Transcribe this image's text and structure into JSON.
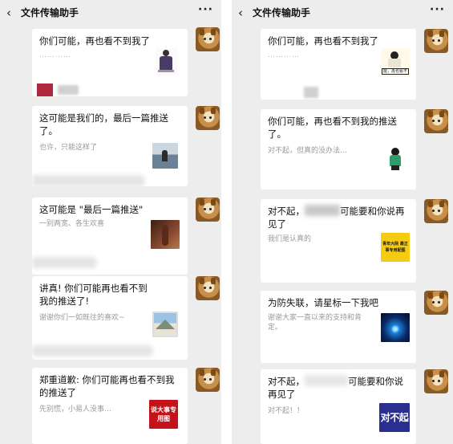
{
  "left": {
    "header": {
      "back_icon": "chevron-left-icon",
      "title": "文件传输助手",
      "more_label": "···"
    },
    "cards": [
      {
        "title": "你们可能，再也看不到我了",
        "desc": "…………",
        "thumb": "figure"
      },
      {
        "title": "这可能是我们的，最后一篇推送了。",
        "desc": "也许，只能这样了",
        "thumb": "sea"
      },
      {
        "title": "这可能是 \"最后一篇推送\"",
        "desc": "一别两宽、各生欢喜",
        "thumb": "dark"
      },
      {
        "title": "讲真! 你们可能再也看不到我的推送了!",
        "desc": "谢谢你们一如既往的喜欢~",
        "thumb": "mountain"
      },
      {
        "title": "郑重道歉: 你们可能再也看不到我的推送了",
        "desc": "先别慌，小易人没事…",
        "thumb": "red",
        "thumb_text": "说大事专用图"
      }
    ]
  },
  "right": {
    "header": {
      "back_icon": "chevron-left-icon",
      "title": "文件传输助手",
      "more_label": "···"
    },
    "cards": [
      {
        "title": "你们可能，再也看不到我了",
        "desc": "…………",
        "thumb": "person",
        "thumb_text": "能，再也看不"
      },
      {
        "title": "你们可能，再也看不到我的推送了。",
        "desc": "对不起，但真的没办法…",
        "thumb": "girl"
      },
      {
        "title_a": "对不起，",
        "title_b": "可能要和你说再见了",
        "desc": "我们是认真的",
        "thumb": "yellow",
        "thumb_text": "青年大院 最正事专用配图"
      },
      {
        "title": "为防失联，请星标一下我吧",
        "desc": "谢谢大家一直以来的支持和肯定。",
        "thumb": "swirl"
      },
      {
        "title_a": "对不起，",
        "title_b": "可能要和你说再见了",
        "desc": "对不起！！",
        "thumb": "navy",
        "thumb_text": "对不起"
      }
    ]
  },
  "colors": {
    "background": "#ededed",
    "card": "#ffffff",
    "desc": "#999999",
    "accent_red": "#c4121a"
  }
}
